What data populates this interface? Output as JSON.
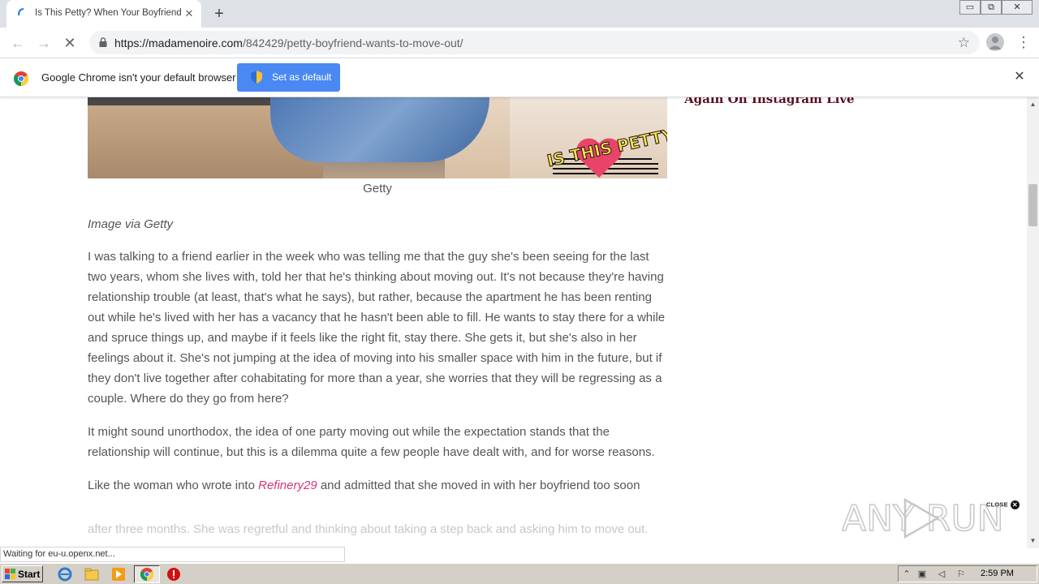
{
  "browser": {
    "tab_title": "Is This Petty? When Your Boyfriend Wa",
    "tab_close": "✕",
    "new_tab": "+",
    "url_host": "https://madamenoire.com",
    "url_path": "/842429/petty-boyfriend-wants-to-move-out/",
    "back": "←",
    "forward": "→",
    "reload": "✕",
    "star": "☆",
    "menu": "⋮",
    "window_controls": [
      "▭",
      "⧉",
      "✕"
    ]
  },
  "infobar": {
    "message": "Google Chrome isn't your default browser",
    "button_label": "Set as default",
    "close": "✕"
  },
  "page": {
    "sidebar_headline": "Again On Instagram Live",
    "image_caption": "Getty",
    "credit": "Image via Getty",
    "paragraphs": [
      "I was talking to a friend earlier in the week who was telling me that the guy she's been seeing for the last two years, whom she lives with, told her that he's thinking about moving out. It's not because they're having relationship trouble (at least, that's what he says), but rather, because the apartment he has been renting out while he's lived with her has a vacancy that he hasn't been able to fill. He wants to stay there for a while and spruce things up, and maybe if it feels like the right fit, stay there. She gets it, but she's also in her feelings about it. She's not jumping at the idea of moving into his smaller space with him in the future, but if they don't live together after cohabitating for more than a year, she worries that they will be regressing as a couple. Where do they go from here?",
      "It might sound unorthodox, the idea of one party moving out while the expectation stands that the relationship will continue, but this is a dilemma quite a few people have dealt with, and for worse reasons."
    ],
    "para3_before": "Like the woman who wrote into ",
    "para3_link": "Refinery29",
    "para3_after": " and admitted that she moved in with her boyfriend too soon",
    "faded_line": "after three months. She was regretful and thinking about taking a step back and asking him to move out."
  },
  "ad": {
    "close_label": "CLOSE",
    "close_x": "✕"
  },
  "watermark": "ANY RUN",
  "status": "Waiting for eu-u.openx.net...",
  "taskbar": {
    "start_label": "Start",
    "clock": "2:59 PM"
  },
  "colors": {
    "accent_button": "#4a89f3",
    "link": "#d6337a",
    "sidebar_headline": "#5a1020",
    "body_text": "#555555"
  }
}
